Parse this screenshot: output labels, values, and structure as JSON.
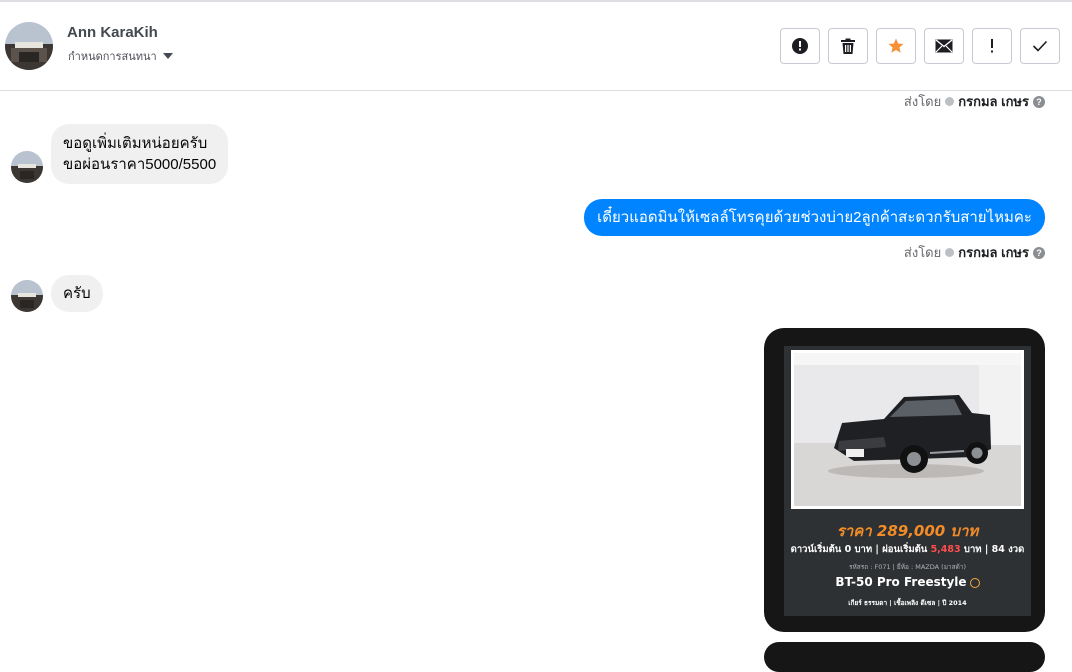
{
  "header": {
    "name": "Ann KaraKih",
    "subtitle": "กำหนดการสนทนา",
    "actions": [
      {
        "icon": "alert-circle-icon",
        "label": "!"
      },
      {
        "icon": "trash-icon"
      },
      {
        "icon": "star-icon",
        "color": "#f7923b"
      },
      {
        "icon": "envelope-icon"
      },
      {
        "icon": "exclamation-icon",
        "label": "!"
      },
      {
        "icon": "check-icon"
      }
    ]
  },
  "messages": {
    "sent_by_prefix": "ส่งโดย",
    "sent_by_name": "กรกมล เกษร",
    "incoming_1_line1": "ขอดูเพิ่มเติมหน่อยครับ",
    "incoming_1_line2": "ขอผ่อนราคา5000/5500",
    "outgoing_1": "เดี๋ยวแอดมินให้เซลล์โทรคุยด้วยช่วงบ่าย2ลูกค้าสะดวกรับสายไหมคะ",
    "incoming_2": "ครับ"
  },
  "car_card": {
    "price": "ราคา 289,000 บาท",
    "down_prefix": "ดาวน์เริ่มต้น 0 บาท | ผ่อนเริ่มต้น ",
    "monthly": "5,483",
    "down_suffix": " บาท | 84 งวด",
    "code_line": "รหัสรถ : F071 | ยี่ห้อ : MAZDA (มาสด้า)",
    "model": "BT-50 Pro Freestyle",
    "specs": "เกียร์ ธรรมดา  |  เชื้อเพลิง ดีเซล  |  ปี 2014"
  },
  "colors": {
    "accent": "#0084ff",
    "incoming_bubble": "#f0f0f0",
    "price": "#f28c28",
    "card_bg": "#161616"
  }
}
